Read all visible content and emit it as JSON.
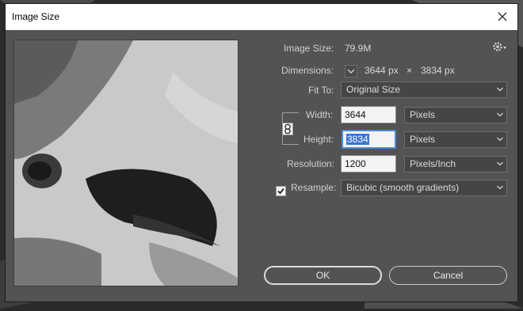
{
  "dialog": {
    "title": "Image Size",
    "image_size_label": "Image Size:",
    "image_size_value": "79.9M",
    "dimensions_label": "Dimensions:",
    "dim_width": "3644 px",
    "dim_times": "×",
    "dim_height": "3834 px",
    "fit_to_label": "Fit To:",
    "fit_to_value": "Original Size",
    "width_label": "Width:",
    "width_value": "3644",
    "width_unit": "Pixels",
    "height_label": "Height:",
    "height_value": "3834",
    "height_unit": "Pixels",
    "resolution_label": "Resolution:",
    "resolution_value": "1200",
    "resolution_unit": "Pixels/Inch",
    "resample_label": "Resample:",
    "resample_checked": true,
    "resample_value": "Bicubic (smooth gradients)",
    "ok_label": "OK",
    "cancel_label": "Cancel"
  },
  "icons": {
    "close": "close-icon",
    "gear": "gear-icon",
    "chain": "chain-link-icon",
    "chevron": "chevron-down-icon"
  },
  "colors": {
    "dialog_bg": "#535353",
    "field_bg": "#454545",
    "input_bg": "#f3f3f3",
    "focus": "#4a8ad6",
    "selection": "#3b74cf"
  }
}
